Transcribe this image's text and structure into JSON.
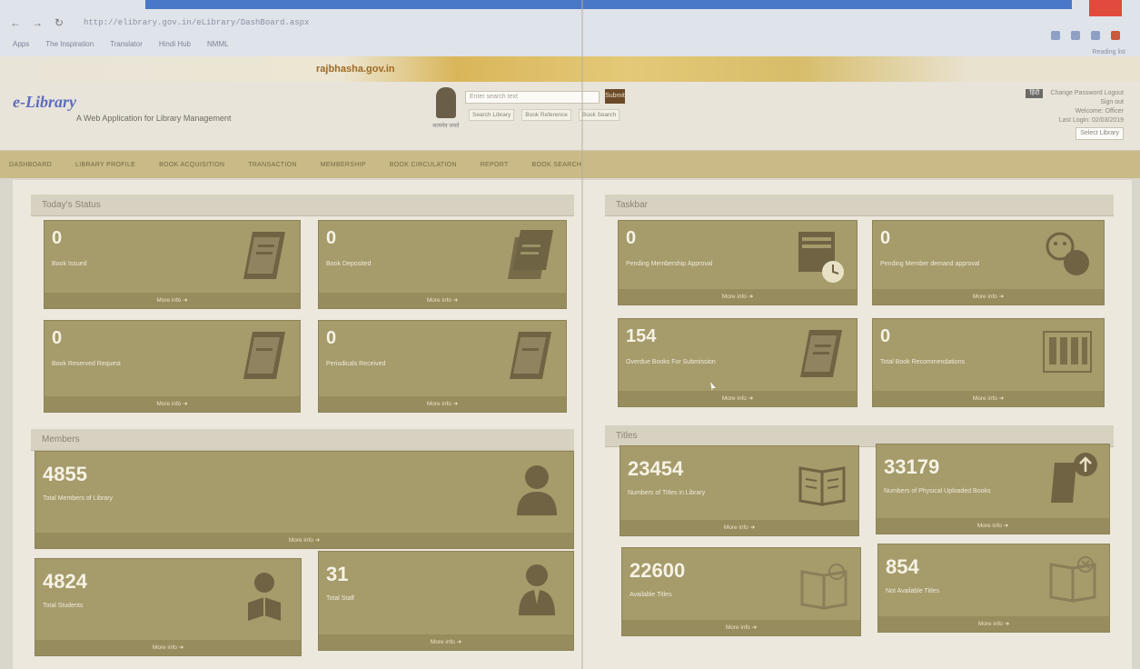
{
  "browser": {
    "url": "http://elibrary.gov.in/eLibrary/DashBoard.aspx",
    "bookmarks": [
      "Apps",
      "The Inspiration",
      "Translator",
      "Hindi Hub",
      "NMML"
    ],
    "reading_list": "Reading list"
  },
  "banner": {
    "brand": "rajbhasha.gov.in"
  },
  "header": {
    "logo": "e-Library",
    "tagline": "A Web Application for Library Management",
    "emblem_caption": "सत्यमेव जयते",
    "search_placeholder": "Enter search text",
    "search_button": "Submit",
    "search_options": [
      "Search Library",
      "Book Reference",
      "Book Search"
    ],
    "user": {
      "lang_label": "हिंदी",
      "links": [
        "Change Password",
        "Logout",
        "Sign out"
      ],
      "greeting": "Welcome: Officer",
      "last_login": "Last Login: 02/03/2019",
      "selector": "Select Library"
    }
  },
  "nav": {
    "items": [
      "DASHBOARD",
      "LIBRARY PROFILE",
      "BOOK ACQUISITION",
      "TRANSACTION",
      "MEMBERSHIP",
      "BOOK CIRCULATION",
      "REPORT",
      "BOOK SEARCH"
    ]
  },
  "sections": {
    "todays_status": "Today's Status",
    "taskbar": "Taskbar",
    "members": "Members",
    "titles": "Titles"
  },
  "more_info": "More info",
  "cards": {
    "books_issued": {
      "value": "0",
      "label": "Book Issued",
      "icon": "book-icon"
    },
    "books_deposited": {
      "value": "0",
      "label": "Book Deposited",
      "icon": "books-stack-icon"
    },
    "books_reserved": {
      "value": "0",
      "label": "Book Reserved Request",
      "icon": "book-icon"
    },
    "periodicals_received": {
      "value": "0",
      "label": "Periodicals Received",
      "icon": "book-icon"
    },
    "pending_membership": {
      "value": "0",
      "label": "Pending Membership Approval",
      "icon": "calendar-clock-icon"
    },
    "pending_member_demands": {
      "value": "0",
      "label": "Pending Member demand approval",
      "icon": "faces-icon"
    },
    "overdue_books": {
      "value": "154",
      "label": "Overdue Books For Submission",
      "icon": "book-icon"
    },
    "book_recommendations": {
      "value": "0",
      "label": "Total Book Recommendations",
      "icon": "shelf-icon"
    },
    "total_members": {
      "value": "4855",
      "label": "Total Members of Library",
      "icon": "user-icon"
    },
    "total_students": {
      "value": "4824",
      "label": "Total Students",
      "icon": "reader-icon"
    },
    "total_staff": {
      "value": "31",
      "label": "Total Staff",
      "icon": "staff-icon"
    },
    "titles_in_library": {
      "value": "23454",
      "label": "Numbers of Titles in Library",
      "icon": "open-book-icon"
    },
    "physical_books": {
      "value": "33179",
      "label": "Numbers of Physical Uploaded Books",
      "icon": "upload-book-icon"
    },
    "available_titles": {
      "value": "22600",
      "label": "Available Titles",
      "icon": "open-book-check-icon"
    },
    "not_available_titles": {
      "value": "854",
      "label": "Not Available Titles",
      "icon": "open-book-cross-icon"
    }
  },
  "colors": {
    "card_bg": "#a59b6b",
    "card_footer": "#978c5d",
    "nav_bg": "#c9ba88",
    "icon": "#6f6343"
  }
}
